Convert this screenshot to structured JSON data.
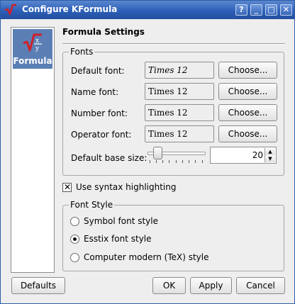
{
  "window": {
    "title": "Configure KFormula",
    "help_button": "?",
    "minimize_button": "_",
    "maximize_button": "□",
    "close_button": "✕"
  },
  "sidebar": {
    "items": [
      {
        "label": "Formula",
        "icon": "kformula-icon",
        "selected": true
      }
    ]
  },
  "page": {
    "title": "Formula Settings"
  },
  "fonts_group": {
    "title": "Fonts",
    "rows": [
      {
        "label": "Default font:",
        "value": "Times 12",
        "button": "Choose..."
      },
      {
        "label": "Name font:",
        "value": "Times 12",
        "button": "Choose..."
      },
      {
        "label": "Number font:",
        "value": "Times 12",
        "button": "Choose..."
      },
      {
        "label": "Operator font:",
        "value": "Times 12",
        "button": "Choose..."
      }
    ],
    "base_size_label": "Default base size:",
    "base_size_value": "20"
  },
  "syntax_highlighting": {
    "label": "Use syntax highlighting",
    "checked": true
  },
  "font_style_group": {
    "title": "Font Style",
    "options": [
      {
        "label": "Symbol font style",
        "selected": false
      },
      {
        "label": "Esstix font style",
        "selected": true
      },
      {
        "label": "Computer modern (TeX) style",
        "selected": false
      }
    ]
  },
  "footer": {
    "defaults_label": "Defaults",
    "ok_label": "OK",
    "apply_label": "Apply",
    "cancel_label": "Cancel"
  },
  "colors": {
    "titlebar": "#2c5fb8",
    "sidebar_selected": "#5b7fb5",
    "app_icon": "#d0202a"
  }
}
